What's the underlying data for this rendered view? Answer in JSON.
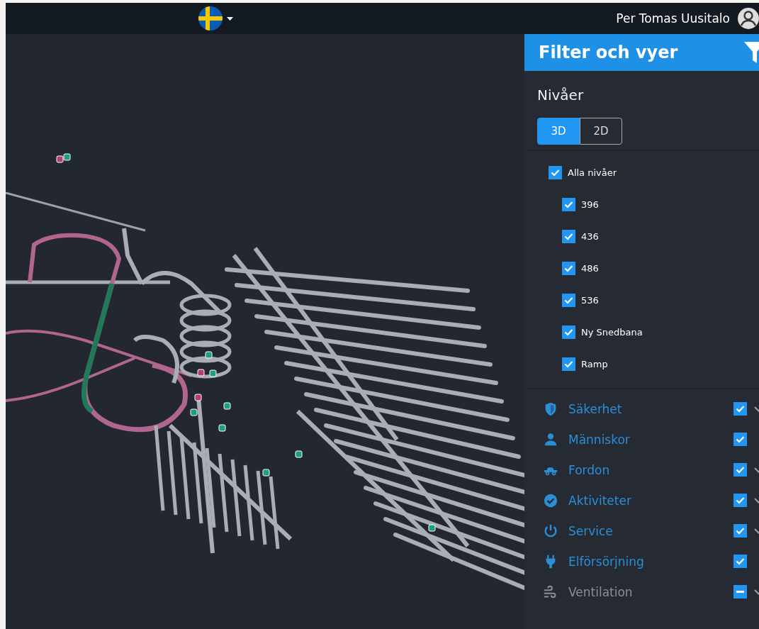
{
  "topbar": {
    "user_name": "Per Tomas Uusitalo"
  },
  "panel": {
    "title": "Filter och vyer",
    "levels_heading": "Nivåer",
    "view_modes": [
      {
        "label": "3D",
        "selected": true
      },
      {
        "label": "2D",
        "selected": false
      }
    ],
    "all_levels": {
      "label": "Alla nivåer",
      "checked": true
    },
    "levels": [
      {
        "label": "396",
        "checked": true
      },
      {
        "label": "436",
        "checked": true
      },
      {
        "label": "486",
        "checked": true
      },
      {
        "label": "536",
        "checked": true
      },
      {
        "label": "Ny Snedbana",
        "checked": true
      },
      {
        "label": "Ramp",
        "checked": true
      }
    ],
    "categories": [
      {
        "kind": "shield",
        "label": "Säkerhet",
        "checked": true,
        "indeterminate": false,
        "expandable": true
      },
      {
        "kind": "person",
        "label": "Människor",
        "checked": true,
        "indeterminate": false,
        "expandable": false
      },
      {
        "kind": "vehicle",
        "label": "Fordon",
        "checked": true,
        "indeterminate": false,
        "expandable": true
      },
      {
        "kind": "check",
        "label": "Aktiviteter",
        "checked": true,
        "indeterminate": false,
        "expandable": true
      },
      {
        "kind": "power",
        "label": "Service",
        "checked": true,
        "indeterminate": false,
        "expandable": true
      },
      {
        "kind": "plug",
        "label": "Elförsörjning",
        "checked": true,
        "indeterminate": false,
        "expandable": false
      },
      {
        "kind": "wind",
        "label": "Ventilation",
        "indeterminate": true,
        "expandable": true
      }
    ]
  }
}
